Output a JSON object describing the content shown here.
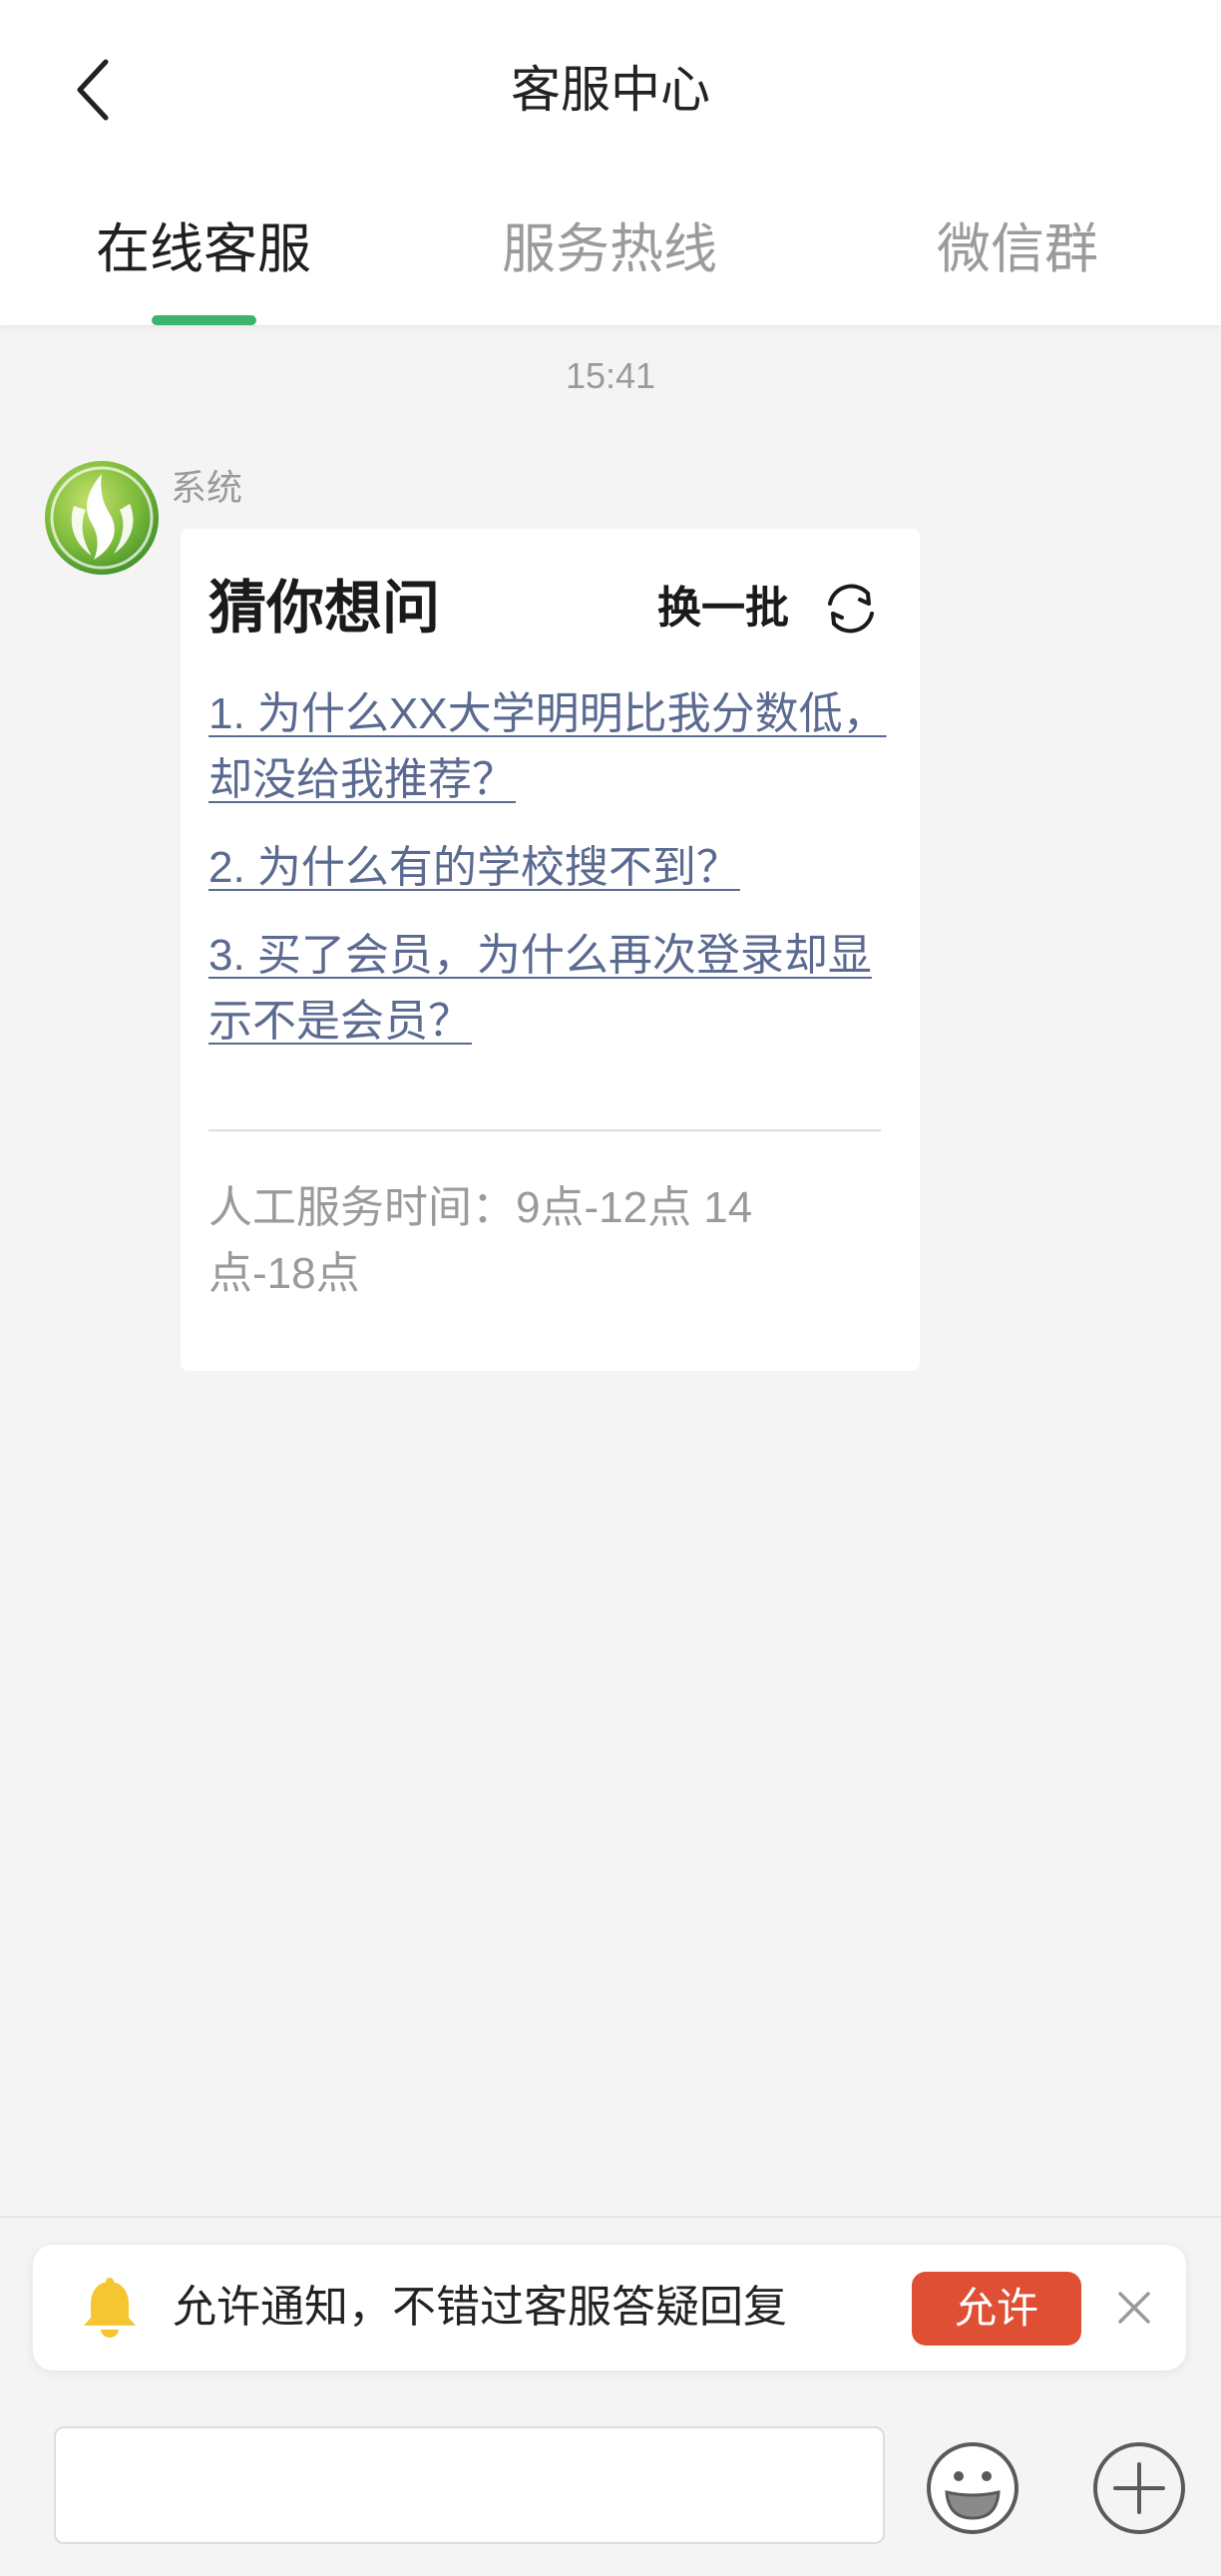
{
  "header": {
    "title": "客服中心",
    "back_icon": "chevron-left-icon"
  },
  "tabs": [
    {
      "label": "在线客服"
    },
    {
      "label": "服务热线"
    },
    {
      "label": "微信群"
    }
  ],
  "active_tab_index": 0,
  "chat": {
    "timestamp": "15:41",
    "sender": "系统",
    "avatar_icon": "leaf-logo-icon",
    "card": {
      "title": "猜你想问",
      "refresh_label": "换一批",
      "refresh_icon": "refresh-icon",
      "questions": [
        "1. 为什么XX大学明明比我分数低，却没给我推荐？",
        "2. 为什么有的学校搜不到？",
        "3. 买了会员，为什么再次登录却显示不是会员？"
      ],
      "service_hours": "人工服务时间：9点-12点 14点-18点"
    }
  },
  "notify": {
    "icon": "bell-icon",
    "text": "允许通知，不错过客服答疑回复",
    "allow_label": "允许",
    "close_icon": "close-icon"
  },
  "input": {
    "value": "",
    "emoji_icon": "emoji-icon",
    "plus_icon": "plus-icon"
  },
  "colors": {
    "accent": "#3cb470",
    "link": "#5b6a90",
    "allow_button": "#df4f34",
    "bell": "#f5c532",
    "background": "#f4f4f4"
  }
}
